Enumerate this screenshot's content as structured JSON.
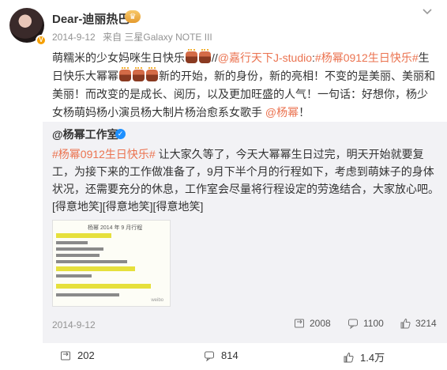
{
  "author": {
    "name": "Dear-迪丽热巴",
    "time": "2014-9-12",
    "source": "来自 三星Galaxy NOTE III"
  },
  "post": {
    "text_a": "萌糯米的少女妈咪生日快乐",
    "text_b": "//",
    "mention_studio": "@嘉行天下J-studio",
    "text_c": ":",
    "hashtag": "#杨幂0912生日快乐#",
    "text_d": "生日快乐大幂幂",
    "text_e": "新的开始，新的身份，新的亮相！不变的是美丽、美丽和美丽！而改变的是成长、阅历，以及更加旺盛的人气！一句话：好想你，杨少女杨萌妈杨小演员杨大制片杨治愈系女歌手 ",
    "mention_yang": "@杨幂",
    "text_f": "！"
  },
  "repost": {
    "user": "@杨幂工作室",
    "hashtag": "#杨幂0912生日快乐#",
    "text": " 让大家久等了，今天大幂幂生日过完，明天开始就要复工，为接下来的工作做准备了，9月下半个月的行程如下，考虑到萌妹子的身体状况，还需要充分的休息，工作室会尽量将行程设定的劳逸结合，大家放心吧。[得意地笑][得意地笑][得意地笑]",
    "image_title": "杨幂 2014 年 9 月行程",
    "time": "2014-9-12",
    "reposts": "2008",
    "comments": "1100",
    "likes": "3214"
  },
  "actions": {
    "reposts": "202",
    "comments": "814",
    "likes": "1.4万"
  },
  "colors": {
    "link": "#eb7350",
    "muted": "#939393",
    "repost_bg": "#f2f2f5"
  },
  "icons": [
    "more-chevron-icon",
    "verified-badge-icon",
    "medal-icon",
    "repost-icon",
    "comment-icon",
    "like-icon"
  ]
}
